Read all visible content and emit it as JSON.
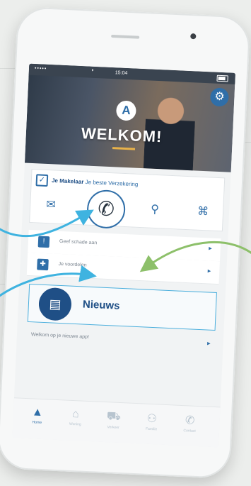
{
  "statusbar": {
    "signal": "•••••",
    "time": "15:04"
  },
  "hero": {
    "logo_letter": "A",
    "title": "WELKOM!"
  },
  "card": {
    "brand_name": "Je Makelaar",
    "brand_tagline": "Je beste Verzekering",
    "icons": [
      "mail-icon",
      "phone-icon",
      "location-icon",
      "globe-icon"
    ]
  },
  "list": [
    {
      "label": "Geef schade aan",
      "icon": "report-icon"
    },
    {
      "label": "Je voordelen",
      "icon": "gift-icon"
    }
  ],
  "news": {
    "title": "Nieuws",
    "subtitle": "Welkom op je nieuwe app!"
  },
  "bottom_nav": [
    {
      "label": "Home",
      "icon": "home-icon",
      "active": true
    },
    {
      "label": "Woning",
      "icon": "house-icon",
      "active": false
    },
    {
      "label": "Verkeer",
      "icon": "car-icon",
      "active": false
    },
    {
      "label": "Familie",
      "icon": "family-icon",
      "active": false
    },
    {
      "label": "Contact",
      "icon": "contact-icon",
      "active": false
    }
  ],
  "colors": {
    "brand": "#2f6ea8",
    "brand_dark": "#1f4f86",
    "accent_arrow_blue": "#3fb3e0",
    "accent_arrow_green": "#8dc06a"
  }
}
